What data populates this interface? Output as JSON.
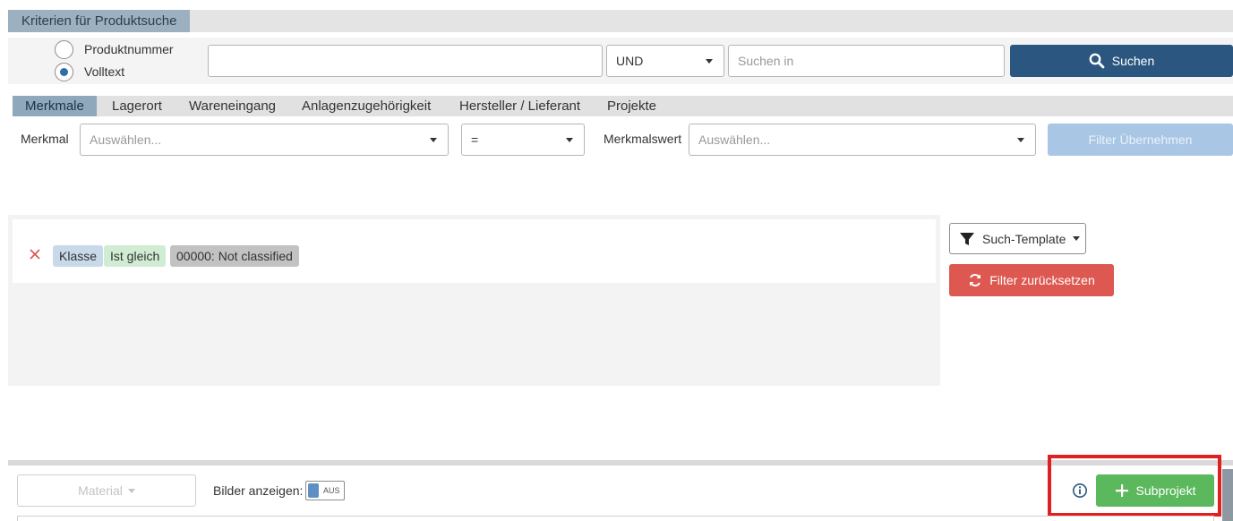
{
  "header": {
    "title": "Kriterien für Produktsuche"
  },
  "search": {
    "mode_options": [
      {
        "label": "Produktnummer",
        "checked": false
      },
      {
        "label": "Volltext",
        "checked": true
      }
    ],
    "query_value": "",
    "operator_value": "UND",
    "search_in_placeholder": "Suchen in",
    "search_button": "Suchen"
  },
  "tabs": [
    {
      "label": "Merkmale",
      "active": true
    },
    {
      "label": "Lagerort",
      "active": false
    },
    {
      "label": "Wareneingang",
      "active": false
    },
    {
      "label": "Anlagenzugehörigkeit",
      "active": false
    },
    {
      "label": "Hersteller / Lieferant",
      "active": false
    },
    {
      "label": "Projekte",
      "active": false
    }
  ],
  "merkmal_filter": {
    "merkmal_label": "Merkmal",
    "merkmal_placeholder": "Auswählen...",
    "comparator_value": "=",
    "value_label": "Merkmalswert",
    "value_placeholder": "Auswählen...",
    "apply_button": "Filter Übernehmen"
  },
  "active_filters": [
    {
      "field": "Klasse",
      "operator": "Ist gleich",
      "value": "00000: Not classified"
    }
  ],
  "actions": {
    "template_button": "Such-Template",
    "reset_button": "Filter zurücksetzen"
  },
  "results_toolbar": {
    "material_button": "Material",
    "show_images_label": "Bilder anzeigen:",
    "show_images_toggle": "AUS",
    "subproject_button": "Subprojekt"
  },
  "colors": {
    "primary": "#2b5680",
    "success": "#5cb85c",
    "danger": "#dd5850",
    "highlight": "#e0201f"
  }
}
